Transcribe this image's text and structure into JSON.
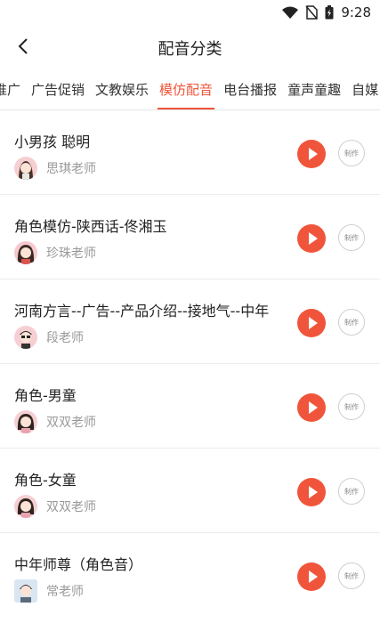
{
  "status": {
    "time": "9:28"
  },
  "header": {
    "title": "配音分类"
  },
  "tabs": [
    {
      "label": "推广"
    },
    {
      "label": "广告促销"
    },
    {
      "label": "文教娱乐"
    },
    {
      "label": "模仿配音",
      "active": true
    },
    {
      "label": "电台播报"
    },
    {
      "label": "童声童趣"
    },
    {
      "label": "自媒"
    }
  ],
  "items": [
    {
      "title": "小男孩 聪明",
      "teacher": "思琪老师",
      "make_label": "制作"
    },
    {
      "title": "角色模仿-陕西话-佟湘玉",
      "teacher": "珍珠老师",
      "make_label": "制作"
    },
    {
      "title": "河南方言--广告--产品介绍--接地气--中年",
      "teacher": "段老师",
      "make_label": "制作"
    },
    {
      "title": "角色-男童",
      "teacher": "双双老师",
      "make_label": "制作"
    },
    {
      "title": "角色-女童",
      "teacher": "双双老师",
      "make_label": "制作"
    },
    {
      "title": "中年师尊（角色音）",
      "teacher": "常老师",
      "make_label": "制作"
    }
  ],
  "colors": {
    "accent": "#f0553b"
  }
}
